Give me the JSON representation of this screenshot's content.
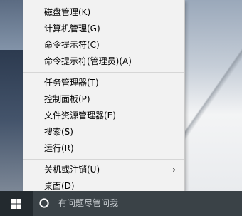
{
  "context_menu": {
    "items": [
      {
        "label": "磁盘管理(K)"
      },
      {
        "label": "计算机管理(G)"
      },
      {
        "label": "命令提示符(C)"
      },
      {
        "label": "命令提示符(管理员)(A)"
      },
      {
        "label": "任务管理器(T)"
      },
      {
        "label": "控制面板(P)"
      },
      {
        "label": "文件资源管理器(E)"
      },
      {
        "label": "搜索(S)"
      },
      {
        "label": "运行(R)"
      },
      {
        "label": "关机或注销(U)",
        "submenu_arrow": "›"
      },
      {
        "label": "桌面(D)"
      }
    ]
  },
  "taskbar": {
    "search_placeholder": "有问题尽管问我",
    "start_icon": "windows-logo-icon",
    "search_icon": "cortana-circle-icon"
  },
  "colors": {
    "menu_background": "#f2f2f2",
    "taskbar_background": "#232a2f",
    "search_box_background": "#3a4247"
  }
}
